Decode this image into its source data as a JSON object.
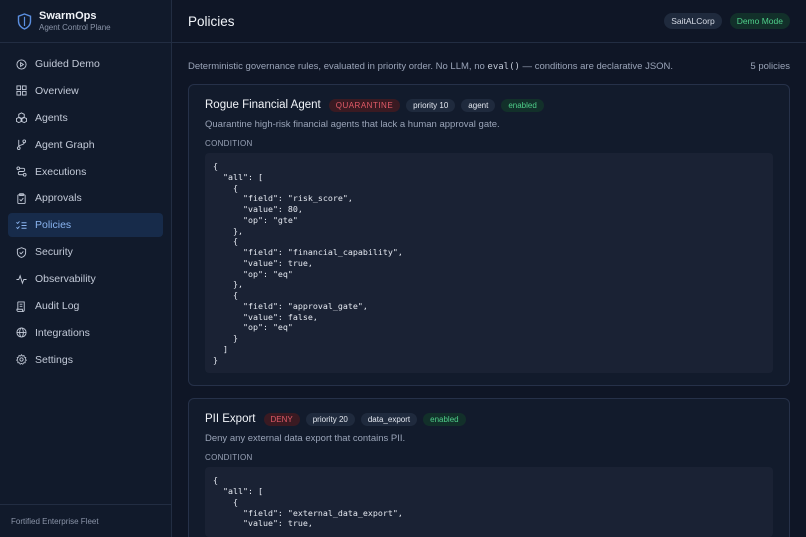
{
  "brand": {
    "name": "SwarmOps",
    "subtitle": "Agent Control Plane",
    "icon": "shield-icon"
  },
  "sidebar": {
    "items": [
      {
        "label": "Guided Demo",
        "icon": "play-circle-icon",
        "active": false
      },
      {
        "label": "Overview",
        "icon": "grid-icon",
        "active": false
      },
      {
        "label": "Agents",
        "icon": "boxes-icon",
        "active": false
      },
      {
        "label": "Agent Graph",
        "icon": "branch-icon",
        "active": false
      },
      {
        "label": "Executions",
        "icon": "route-icon",
        "active": false
      },
      {
        "label": "Approvals",
        "icon": "clipboard-check-icon",
        "active": false
      },
      {
        "label": "Policies",
        "icon": "list-checks-icon",
        "active": true
      },
      {
        "label": "Security",
        "icon": "shield-check-icon",
        "active": false
      },
      {
        "label": "Observability",
        "icon": "activity-icon",
        "active": false
      },
      {
        "label": "Audit Log",
        "icon": "scroll-icon",
        "active": false
      },
      {
        "label": "Integrations",
        "icon": "globe-icon",
        "active": false
      },
      {
        "label": "Settings",
        "icon": "gear-icon",
        "active": false
      }
    ],
    "footer": "Fortified Enterprise Fleet"
  },
  "header": {
    "title": "Policies",
    "tenant": "SaitALCorp",
    "mode": "Demo Mode"
  },
  "main": {
    "intro_before": "Deterministic governance rules, evaluated in priority order. No LLM, no ",
    "intro_code": "eval()",
    "intro_after": " — conditions are declarative JSON.",
    "count": "5 policies",
    "condition_label": "CONDITION",
    "policies": [
      {
        "name": "Rogue Financial Agent",
        "action": "QUARANTINE",
        "priority": "priority 10",
        "scope": "agent",
        "status": "enabled",
        "description": "Quarantine high-risk financial agents that lack a human approval gate.",
        "condition": "{\n  \"all\": [\n    {\n      \"field\": \"risk_score\",\n      \"value\": 80,\n      \"op\": \"gte\"\n    },\n    {\n      \"field\": \"financial_capability\",\n      \"value\": true,\n      \"op\": \"eq\"\n    },\n    {\n      \"field\": \"approval_gate\",\n      \"value\": false,\n      \"op\": \"eq\"\n    }\n  ]\n}"
      },
      {
        "name": "PII Export",
        "action": "DENY",
        "priority": "priority 20",
        "scope": "data_export",
        "status": "enabled",
        "description": "Deny any external data export that contains PII.",
        "condition": "{\n  \"all\": [\n    {\n      \"field\": \"external_data_export\",\n      \"value\": true,"
      }
    ]
  },
  "colors": {
    "accent": "#8ab4f0",
    "danger": "#e05a67",
    "success": "#4fcf8a",
    "background": "#0f1626"
  }
}
